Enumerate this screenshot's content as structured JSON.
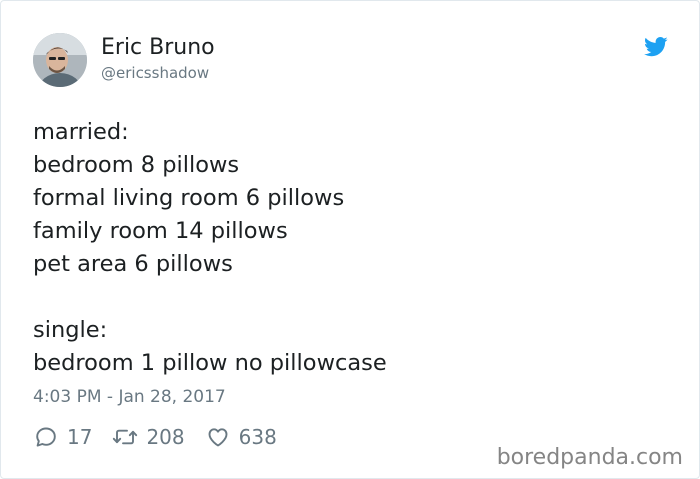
{
  "author": {
    "name": "Eric Bruno",
    "handle": "@ericsshadow",
    "avatar_icon": "profile-photo"
  },
  "brand": {
    "icon": "twitter-bird-icon",
    "color": "#1da1f2"
  },
  "tweet": {
    "lines": [
      "married:",
      "bedroom 8 pillows",
      "formal living room 6 pillows",
      "family room 14 pillows",
      "pet area 6 pillows",
      "",
      "single:",
      "bedroom 1 pillow no pillowcase"
    ],
    "timestamp": "4:03 PM - Jan 28, 2017"
  },
  "stats": {
    "replies": "17",
    "retweets": "208",
    "likes": "638"
  },
  "watermark": "boredpanda.com"
}
